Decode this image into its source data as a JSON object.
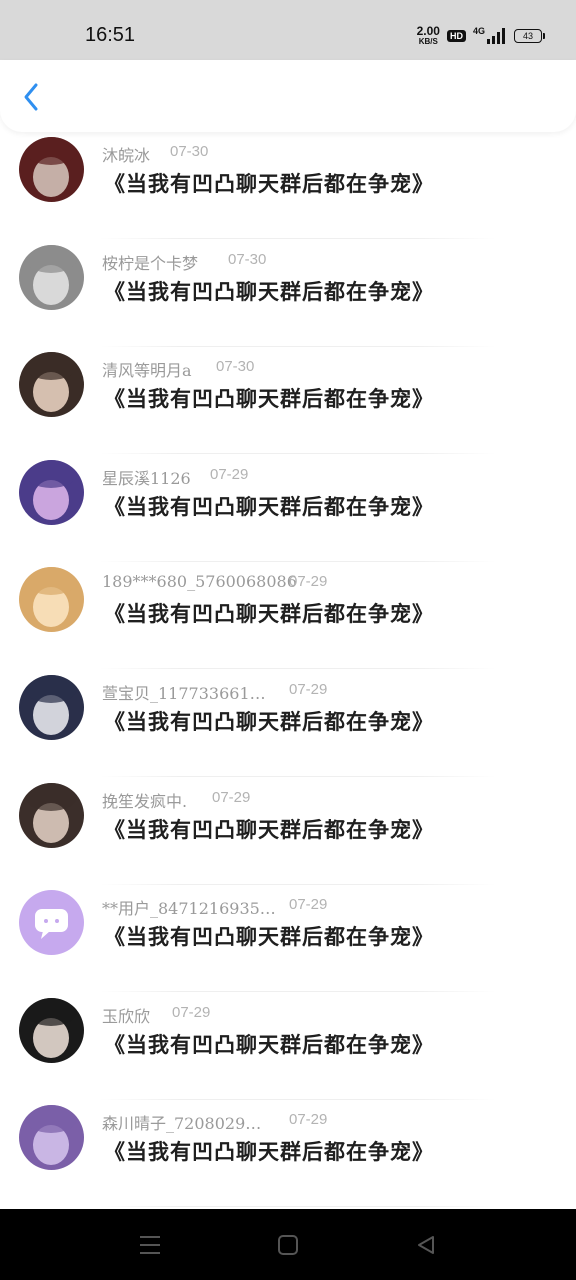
{
  "status_bar": {
    "time": "16:51",
    "net_speed_value": "2.00",
    "net_speed_unit": "KB/S",
    "hd_label": "HD",
    "network_label": "4G",
    "battery": "43"
  },
  "header": {
    "back_icon": "chevron-left-icon",
    "accent_color": "#2f8ff0"
  },
  "list": {
    "items": [
      {
        "username": "沐皖冰",
        "date": "07-30",
        "title": "《当我有凹凸聊天群后都在争宠》",
        "avatar_color": "#5a1f1f",
        "avatar_accent": "#d8c9c0"
      },
      {
        "username": "桉柠是个卡梦",
        "date": "07-30",
        "title": "《当我有凹凸聊天群后都在争宠》",
        "avatar_color": "#8c8c8c",
        "avatar_accent": "#e6e6e6"
      },
      {
        "username": "清风等明月a",
        "date": "07-30",
        "title": "《当我有凹凸聊天群后都在争宠》",
        "avatar_color": "#3a2c26",
        "avatar_accent": "#f1d9c8"
      },
      {
        "username": "星辰溪1126",
        "date": "07-29",
        "title": "《当我有凹凸聊天群后都在争宠》",
        "avatar_color": "#4b3c8a",
        "avatar_accent": "#e0b7ec"
      },
      {
        "username": "189***680_5760068086",
        "date": "07-29",
        "title": "《当我有凹凸聊天群后都在争宠》",
        "avatar_color": "#d9a969",
        "avatar_accent": "#fbe6c4"
      },
      {
        "username": "萱宝贝_117733661…",
        "date": "07-29",
        "title": "《当我有凹凸聊天群后都在争宠》",
        "avatar_color": "#2a2f4a",
        "avatar_accent": "#f0f0f5"
      },
      {
        "username": "挽笙发疯中.",
        "date": "07-29",
        "title": "《当我有凹凸聊天群后都在争宠》",
        "avatar_color": "#3b2e2a",
        "avatar_accent": "#e7d3c8"
      },
      {
        "username": "**用户_8471216935…",
        "date": "07-29",
        "title": "《当我有凹凸聊天群后都在争宠》",
        "avatar_color": "#c6a9ee",
        "avatar_accent": "#ffffff"
      },
      {
        "username": "玉欣欣",
        "date": "07-29",
        "title": "《当我有凹凸聊天群后都在争宠》",
        "avatar_color": "#1a1a1a",
        "avatar_accent": "#f3e6dd"
      },
      {
        "username": "森川晴子_7208029…",
        "date": "07-29",
        "title": "《当我有凹凸聊天群后都在争宠》",
        "avatar_color": "#7b5fa8",
        "avatar_accent": "#d7c5ef"
      }
    ]
  },
  "nav_bar": {
    "menu_icon": "menu-icon",
    "home_icon": "home-square-icon",
    "back_icon": "triangle-back-icon"
  }
}
